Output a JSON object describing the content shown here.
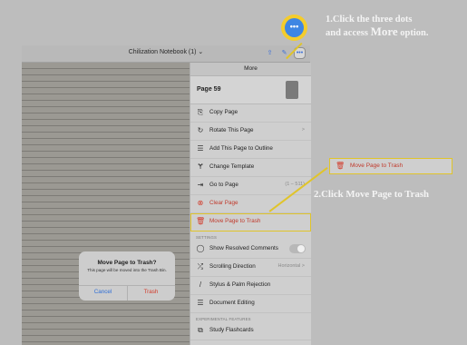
{
  "window": {
    "doc_title": "Chilization Notebook (1) ⌄",
    "toolbar_icons": [
      "export-icon",
      "pen-icon",
      "more-icon"
    ]
  },
  "menu": {
    "title": "More",
    "page_label": "Page 59",
    "items": [
      {
        "icon": "copy-icon",
        "glyph": "⎘",
        "label": "Copy Page",
        "suffix": ""
      },
      {
        "icon": "rotate-icon",
        "glyph": "↻",
        "label": "Rotate This Page",
        "suffix": ">"
      },
      {
        "icon": "outline-icon",
        "glyph": "☰",
        "label": "Add This Page to Outline",
        "suffix": ""
      },
      {
        "icon": "template-icon",
        "glyph": "Ɏ",
        "label": "Change Template",
        "suffix": ""
      },
      {
        "icon": "goto-icon",
        "glyph": "⇥",
        "label": "Go to Page",
        "suffix": "(1 – 511)"
      },
      {
        "icon": "clear-icon",
        "glyph": "⊗",
        "label": "Clear Page",
        "suffix": ""
      },
      {
        "icon": "trash-icon",
        "glyph": "🗑",
        "label": "Move Page to Trash",
        "suffix": ""
      }
    ],
    "settings_label": "SETTINGS",
    "settings": [
      {
        "icon": "comment-icon",
        "glyph": "◯",
        "label": "Show Resolved Comments",
        "suffix": ""
      },
      {
        "icon": "scroll-icon",
        "glyph": "⤮",
        "label": "Scrolling Direction",
        "suffix": "Horizontal >"
      },
      {
        "icon": "stylus-icon",
        "glyph": "/",
        "label": "Stylus & Palm Rejection",
        "suffix": ""
      },
      {
        "icon": "editing-icon",
        "glyph": "☰",
        "label": "Document Editing",
        "suffix": ""
      }
    ],
    "experimental_label": "EXPERIMENTAL FEATURES",
    "experimental": [
      {
        "icon": "flashcards-icon",
        "glyph": "⧉",
        "label": "Study Flashcards",
        "suffix": ""
      }
    ]
  },
  "dialog": {
    "title": "Move Page to Trash?",
    "body": "This page will be moved into the Trash Bin.",
    "cancel": "Cancel",
    "trash": "Trash"
  },
  "callouts": {
    "step1_line1": "1.Click the three dots",
    "step1_line2_pre": "and access ",
    "step1_line2_big": "More",
    "step1_line2_post": " option.",
    "step2": "2.Click Move Page to Trash",
    "box_label": "Move Page to Trash",
    "dots": "•••"
  },
  "colors": {
    "highlight": "#e0c42b",
    "destructive": "#c0392b",
    "accent": "#3e86e3"
  }
}
